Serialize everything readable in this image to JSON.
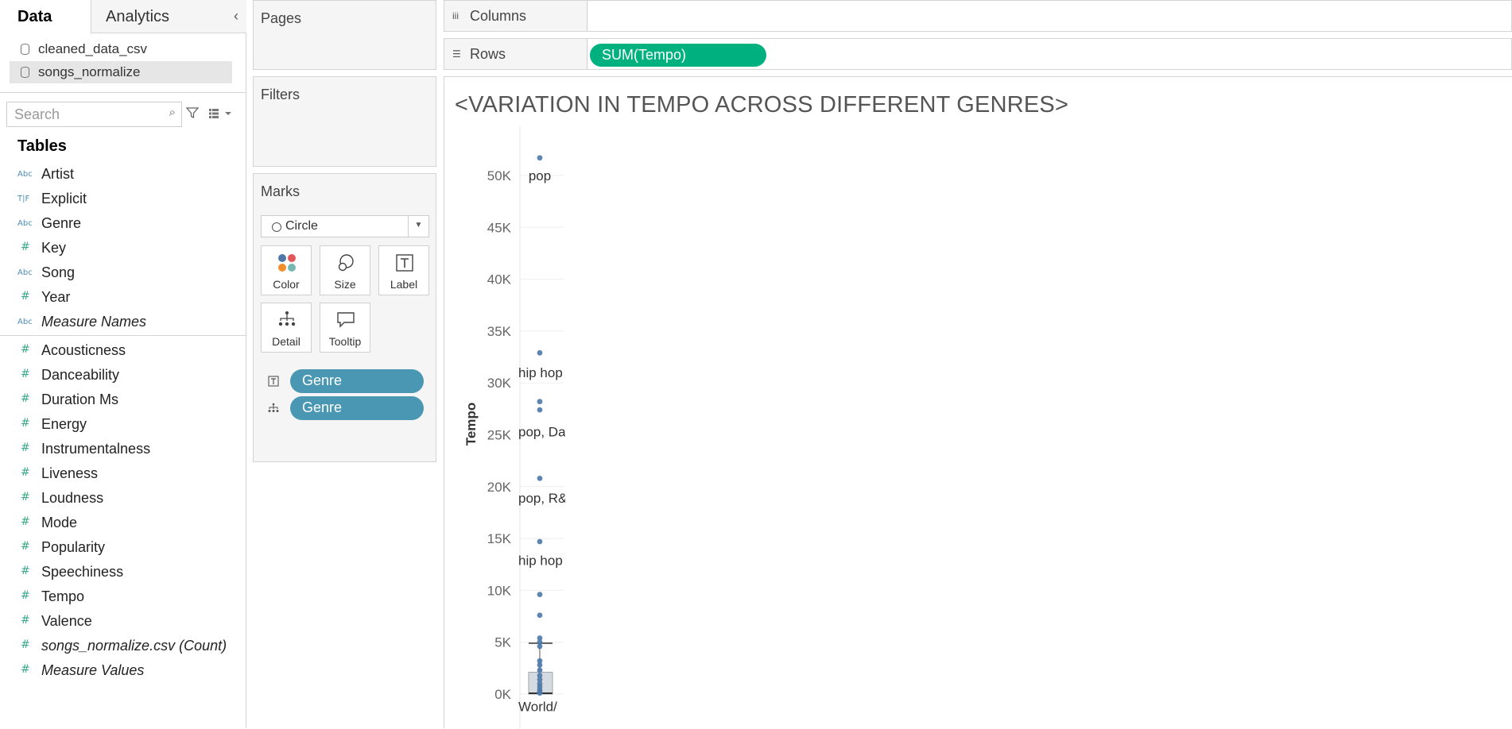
{
  "data_pane": {
    "tabs": {
      "data": "Data",
      "analytics": "Analytics"
    },
    "collapse_glyph": "‹",
    "datasources": [
      "cleaned_data_csv",
      "songs_normalize"
    ],
    "search_placeholder": "Search",
    "tables_header": "Tables",
    "dimensions": [
      {
        "label": "Artist",
        "icon": "Abc"
      },
      {
        "label": "Explicit",
        "icon": "T|F"
      },
      {
        "label": "Genre",
        "icon": "Abc"
      },
      {
        "label": "Key",
        "icon": "#"
      },
      {
        "label": "Song",
        "icon": "Abc"
      },
      {
        "label": "Year",
        "icon": "#"
      },
      {
        "label": "Measure Names",
        "icon": "Abc"
      }
    ],
    "measures": [
      {
        "label": "Acousticness",
        "icon": "#"
      },
      {
        "label": "Danceability",
        "icon": "#"
      },
      {
        "label": "Duration Ms",
        "icon": "#"
      },
      {
        "label": "Energy",
        "icon": "#"
      },
      {
        "label": "Instrumentalness",
        "icon": "#"
      },
      {
        "label": "Liveness",
        "icon": "#"
      },
      {
        "label": "Loudness",
        "icon": "#"
      },
      {
        "label": "Mode",
        "icon": "#"
      },
      {
        "label": "Popularity",
        "icon": "#"
      },
      {
        "label": "Speechiness",
        "icon": "#"
      },
      {
        "label": "Tempo",
        "icon": "#"
      },
      {
        "label": "Valence",
        "icon": "#"
      },
      {
        "label": "songs_normalize.csv (Count)",
        "icon": "#"
      },
      {
        "label": "Measure Values",
        "icon": "#"
      }
    ]
  },
  "cards": {
    "pages": "Pages",
    "filters": "Filters",
    "marks": "Marks",
    "mark_type": "Circle",
    "mark_buttons": {
      "color": "Color",
      "size": "Size",
      "label": "Label",
      "detail": "Detail",
      "tooltip": "Tooltip"
    },
    "mark_pills": [
      {
        "encoding": "label",
        "field": "Genre"
      },
      {
        "encoding": "detail",
        "field": "Genre"
      }
    ]
  },
  "shelves": {
    "columns_label": "Columns",
    "rows_label": "Rows",
    "rows_pill": "SUM(Tempo)"
  },
  "view": {
    "title": "<VARIATION IN TEMPO ACROSS DIFFERENT GENRES>"
  },
  "colors": {
    "dimension_pill": "#4a97b4",
    "measure_pill": "#00b180",
    "mark": "#4e79a7"
  },
  "chart_data": {
    "type": "scatter",
    "ylabel": "Tempo",
    "ylim": [
      0,
      53000
    ],
    "yticks": [
      0,
      5000,
      10000,
      15000,
      20000,
      25000,
      30000,
      35000,
      40000,
      45000,
      50000
    ],
    "ytick_labels": [
      "0K",
      "5K",
      "10K",
      "15K",
      "20K",
      "25K",
      "30K",
      "35K",
      "40K",
      "45K",
      "50K"
    ],
    "points": [
      51700,
      32900,
      28200,
      27400,
      20800,
      14700,
      9600,
      7600,
      5400,
      5000,
      4600,
      3200,
      2800,
      2300,
      1800,
      1400,
      1000,
      700,
      400,
      200,
      100
    ],
    "labels": [
      {
        "text": "pop",
        "y": 50000
      },
      {
        "text": "hip hop",
        "y": 31000
      },
      {
        "text": "pop, Da",
        "y": 25300
      },
      {
        "text": "pop, R&",
        "y": 18900
      },
      {
        "text": "hip hop",
        "y": 12900
      },
      {
        "text": "World/",
        "y": -1200
      }
    ],
    "boxplot": {
      "q1": 0,
      "q3": 2100,
      "whisker_low": 0,
      "whisker_high": 4900
    }
  }
}
